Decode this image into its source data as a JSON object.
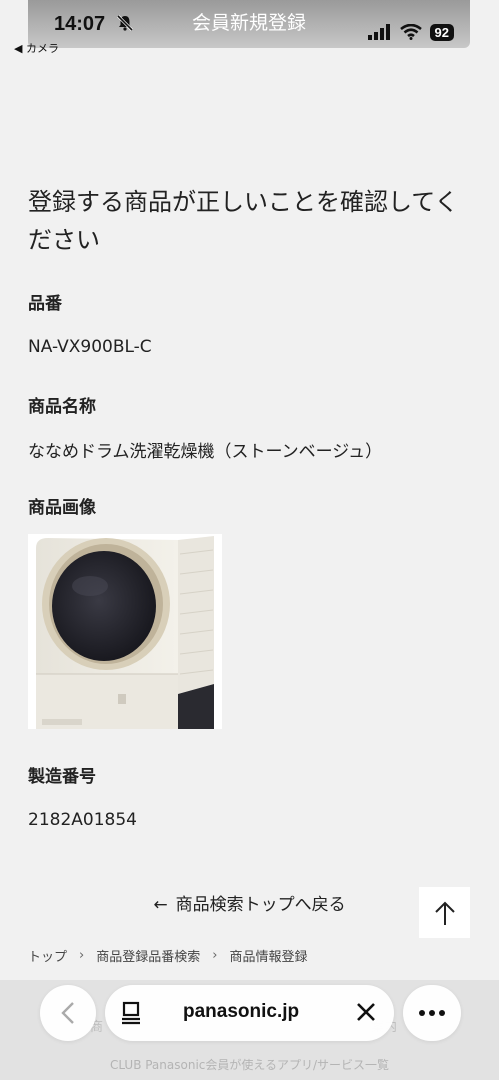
{
  "status_bar": {
    "time": "14:07",
    "title": "会員新規登録",
    "battery": "92",
    "back_app": "◀ カメラ"
  },
  "page": {
    "heading": "登録する商品が正しいことを確認してください",
    "fields": [
      {
        "label": "品番",
        "value": "NA-VX900BL-C"
      },
      {
        "label": "商品名称",
        "value": "ななめドラム洗濯乾燥機（ストーンベージュ）"
      },
      {
        "label": "商品画像"
      },
      {
        "label": "製造番号",
        "value": "2182A01854"
      }
    ],
    "back_link": "商品検索トップへ戻る"
  },
  "breadcrumb": {
    "items": [
      "トップ",
      "商品登録品番検索",
      "商品情報登録"
    ],
    "separator": "›"
  },
  "footer": {
    "partial_text": "商",
    "partial_text_right": "案内",
    "link_text": "CLUB Panasonic会員が使えるアプリ/サービス一覧"
  },
  "browser": {
    "url": "panasonic.jp"
  }
}
